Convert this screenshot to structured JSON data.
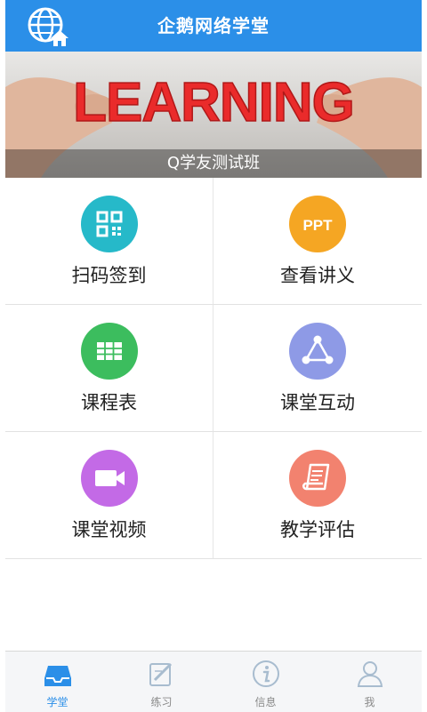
{
  "header": {
    "title": "企鹅网络学堂",
    "logo_icon": "globe-home-icon"
  },
  "banner": {
    "art_text": "LEARNING",
    "caption": "Q学友测试班"
  },
  "grid": {
    "items": [
      {
        "label": "扫码签到",
        "icon": "qr-code-icon",
        "color": "#26b9c9"
      },
      {
        "label": "查看讲义",
        "icon": "ppt-icon",
        "color": "#f5a623"
      },
      {
        "label": "课程表",
        "icon": "table-icon",
        "color": "#3cbd5e"
      },
      {
        "label": "课堂互动",
        "icon": "network-triangle-icon",
        "color": "#8e9ae6"
      },
      {
        "label": "课堂视频",
        "icon": "video-camera-icon",
        "color": "#c36ae6"
      },
      {
        "label": "教学评估",
        "icon": "scroll-document-icon",
        "color": "#f2826f"
      }
    ],
    "ppt_text": "PPT"
  },
  "tabbar": {
    "active_color": "#2b8fe8",
    "items": [
      {
        "label": "学堂",
        "icon": "inbox-tray-icon",
        "active": true
      },
      {
        "label": "练习",
        "icon": "pencil-edit-icon",
        "active": false
      },
      {
        "label": "信息",
        "icon": "info-icon",
        "active": false
      },
      {
        "label": "我",
        "icon": "user-icon",
        "active": false
      }
    ]
  }
}
